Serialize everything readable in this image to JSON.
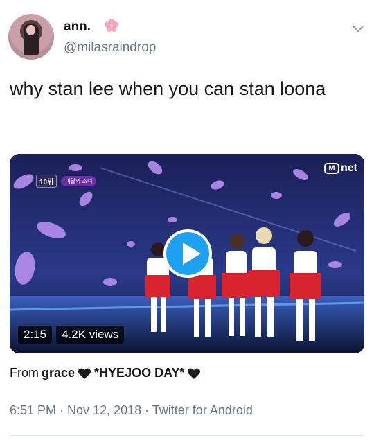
{
  "user": {
    "display_name": "ann.",
    "handle": "@milasraindrop"
  },
  "tweet": {
    "text": "why stan lee when you can stan loona"
  },
  "media": {
    "overlay_brand": "net",
    "overlay_brand_mark": "M",
    "rank_badge": "10위",
    "rank_name": "이달의 소녀",
    "duration": "2:15",
    "views": "4.2K views"
  },
  "source": {
    "prefix": "From",
    "user": "grace",
    "title": "*HYEJOO DAY*"
  },
  "meta": {
    "time": "6:51 PM",
    "date": "Nov 12, 2018",
    "client": "Twitter for Android",
    "separator": " · "
  },
  "colors": {
    "accent": "#1da1f2",
    "muted": "#657786",
    "text": "#14171a"
  },
  "icons": {
    "flower": "cherry-blossom-icon",
    "menu": "chevron-down-icon",
    "play": "play-icon",
    "heart": "black-heart-icon"
  }
}
